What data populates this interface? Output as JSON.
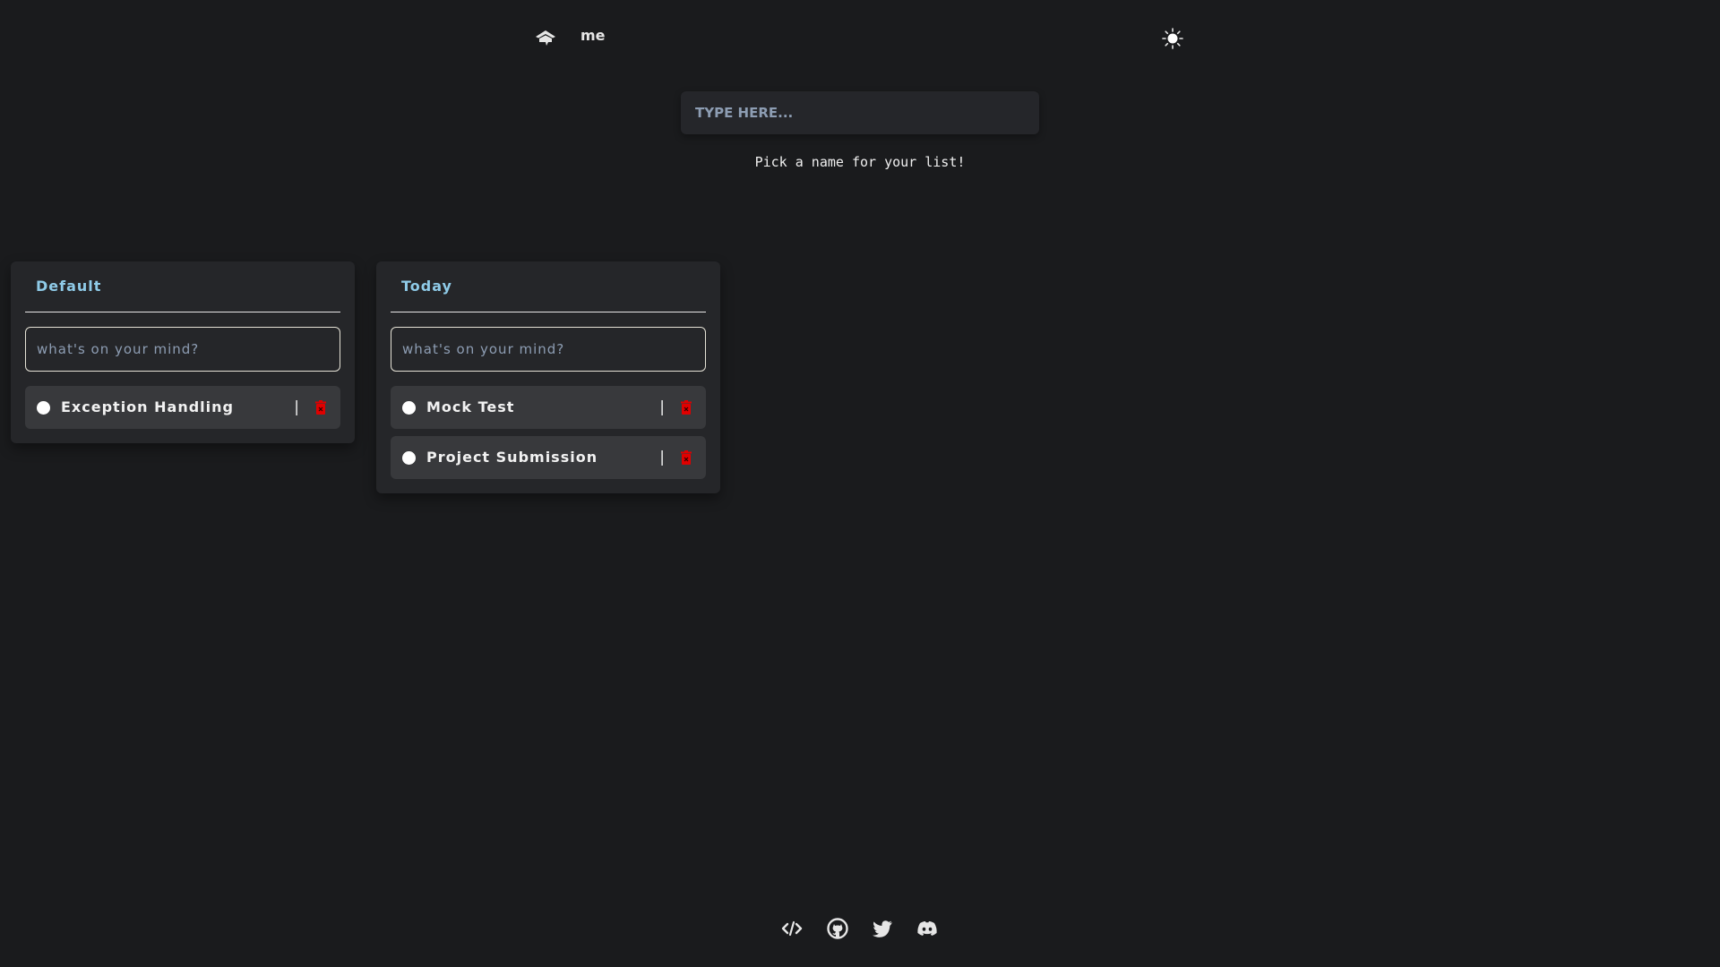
{
  "nav": {
    "home_icon": "graduation-cap-home-icon",
    "me_label": "me",
    "theme_icon": "sun-icon"
  },
  "new_list": {
    "placeholder": "TYPE HERE...",
    "value": "",
    "helper_text": "Pick a name for your list!"
  },
  "lists": [
    {
      "title": "Default",
      "input_placeholder": "what's on your mind?",
      "tasks": [
        {
          "label": "Exception Handling",
          "done": false,
          "separator": "|"
        }
      ]
    },
    {
      "title": "Today",
      "input_placeholder": "what's on your mind?",
      "tasks": [
        {
          "label": "Mock Test",
          "done": false,
          "separator": "|"
        },
        {
          "label": "Project Submission",
          "done": false,
          "separator": "|"
        }
      ]
    }
  ],
  "footer": {
    "icons": [
      "code-icon",
      "github-icon",
      "twitter-icon",
      "discord-icon"
    ]
  },
  "colors": {
    "background": "#1a1b1d",
    "card": "#252629",
    "task": "#38393c",
    "accent_title": "#8fcbe8",
    "delete": "#e00000"
  }
}
